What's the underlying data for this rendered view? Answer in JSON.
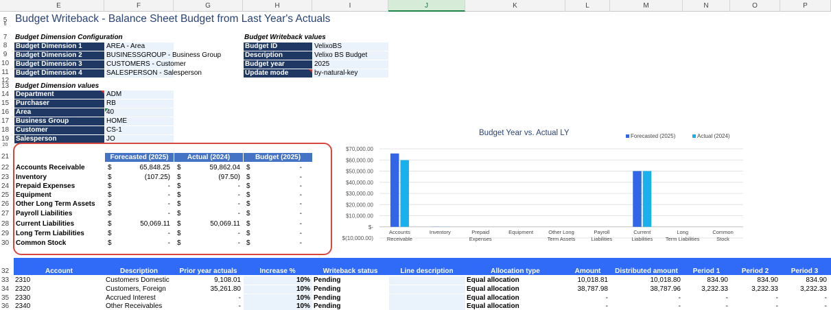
{
  "columns": [
    "E",
    "F",
    "G",
    "H",
    "I",
    "J",
    "K",
    "L",
    "M",
    "N",
    "O",
    "P"
  ],
  "selected_column": "J",
  "row_numbers": [
    "5",
    "6",
    "7",
    "8",
    "9",
    "10",
    "11",
    "12",
    "13",
    "14",
    "15",
    "16",
    "17",
    "18",
    "19",
    "20",
    "21",
    "22",
    "23",
    "24",
    "25",
    "26",
    "27",
    "28",
    "29",
    "30",
    "32",
    "33",
    "34",
    "35",
    "36"
  ],
  "title": "Budget Writeback - Balance Sheet Budget from Last Year's Actuals",
  "dim_config": {
    "heading": "Budget Dimension Configuration",
    "items": [
      {
        "label": "Budget Dimension 1",
        "value": "AREA - Area"
      },
      {
        "label": "Budget Dimension 2",
        "value": "BUSINESSGROUP - Business Group"
      },
      {
        "label": "Budget Dimension 3",
        "value": "CUSTOMERS - Customer"
      },
      {
        "label": "Budget Dimension 4",
        "value": "SALESPERSON - Salesperson"
      }
    ]
  },
  "writeback": {
    "heading": "Budget Writeback values",
    "items": [
      {
        "label": "Budget ID",
        "value": "VelixoBS"
      },
      {
        "label": "Description",
        "value": "Velixo BS Budget"
      },
      {
        "label": "Budget year",
        "value": "2025"
      },
      {
        "label": "Update mode",
        "value": "by-natural-key"
      }
    ]
  },
  "dim_values": {
    "heading": "Budget Dimension values",
    "items": [
      {
        "label": "Department",
        "value": "ADM"
      },
      {
        "label": "Purchaser",
        "value": "RB"
      },
      {
        "label": "Area",
        "value": "40"
      },
      {
        "label": "Business Group",
        "value": "HOME"
      },
      {
        "label": "Customer",
        "value": "CS-1"
      },
      {
        "label": "Salesperson",
        "value": "JO"
      }
    ]
  },
  "balance": {
    "headers": [
      "Forecasted (2025)",
      "Actual (2024)",
      "Budget (2025)"
    ],
    "currency": "$",
    "rows": [
      {
        "account": "Accounts Receivable",
        "forecast": "65,848.25",
        "actual": "59,862.04",
        "budget": "-"
      },
      {
        "account": "Inventory",
        "forecast": "(107.25)",
        "actual": "(97.50)",
        "budget": "-"
      },
      {
        "account": "Prepaid Expenses",
        "forecast": "-",
        "actual": "-",
        "budget": "-"
      },
      {
        "account": "Equipment",
        "forecast": "-",
        "actual": "-",
        "budget": "-"
      },
      {
        "account": "Other Long Term Assets",
        "forecast": "-",
        "actual": "-",
        "budget": "-"
      },
      {
        "account": "Payroll Liabilities",
        "forecast": "-",
        "actual": "-",
        "budget": "-"
      },
      {
        "account": "Current Liabilities",
        "forecast": "50,069.11",
        "actual": "50,069.11",
        "budget": "-"
      },
      {
        "account": "Long Term Liabilities",
        "forecast": "-",
        "actual": "-",
        "budget": "-"
      },
      {
        "account": "Common Stock",
        "forecast": "-",
        "actual": "-",
        "budget": "-"
      }
    ]
  },
  "chart_data": {
    "type": "bar",
    "title": "Budget Year vs. Actual LY",
    "categories": [
      "Accounts Receivable",
      "Inventory",
      "Prepaid Expenses",
      "Equipment",
      "Other Long Term Assets",
      "Payroll Liabilities",
      "Current Liabilities",
      "Long Term Liabilities",
      "Common Stock"
    ],
    "series": [
      {
        "name": "Forecasted (2025)",
        "color": "#3366e6",
        "values": [
          65848.25,
          -107.25,
          0,
          0,
          0,
          0,
          50069.11,
          0,
          0
        ]
      },
      {
        "name": "Actual (2024)",
        "color": "#1ab0ee",
        "values": [
          59862.04,
          -97.5,
          0,
          0,
          0,
          0,
          50069.11,
          0,
          0
        ]
      }
    ],
    "ylim": [
      -10000,
      70000
    ],
    "yticks": [
      -10000,
      0,
      10000,
      20000,
      30000,
      40000,
      50000,
      60000,
      70000
    ],
    "ytick_labels": [
      "$(10,000.00)",
      "$-",
      "$10,000.00",
      "$20,000.00",
      "$30,000.00",
      "$40,000.00",
      "$50,000.00",
      "$60,000.00",
      "$70,000.00"
    ],
    "legend_position": "top-right",
    "grid": true
  },
  "detail": {
    "headers": [
      "Account",
      "Description",
      "Prior year actuals",
      "Increase %",
      "Writeback status",
      "Line description",
      "Allocation type",
      "Amount",
      "Distributed amount",
      "Period 1",
      "Period 2",
      "Period 3"
    ],
    "rows": [
      [
        "2310",
        "Customers Domestic",
        "9,108.01",
        "10%",
        "Pending",
        "",
        "Equal allocation",
        "10,018.81",
        "10,018.80",
        "834.90",
        "834.90",
        "834.90"
      ],
      [
        "2320",
        "Customers, Foreign",
        "35,261.80",
        "10%",
        "Pending",
        "",
        "Equal allocation",
        "38,787.98",
        "38,787.96",
        "3,232.33",
        "3,232.33",
        "3,232.33"
      ],
      [
        "2330",
        "Accrued Interest",
        "-",
        "10%",
        "Pending",
        "",
        "Equal allocation",
        "-",
        "-",
        "-",
        "-",
        "-"
      ],
      [
        "2340",
        "Other Receivables",
        "-",
        "10%",
        "Pending",
        "",
        "Equal allocation",
        "-",
        "-",
        "-",
        "-",
        "-"
      ]
    ]
  }
}
